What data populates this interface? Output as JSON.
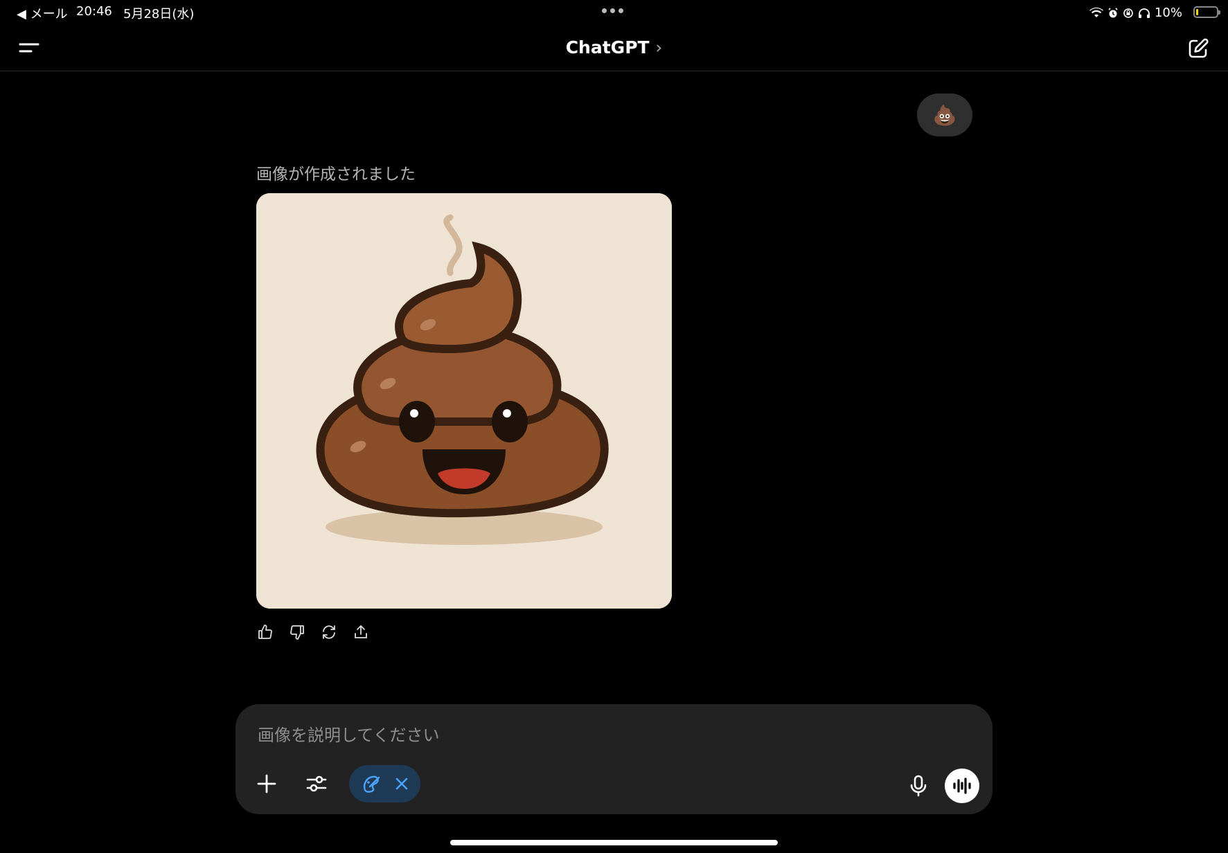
{
  "status_bar": {
    "back_label": "◀ メール",
    "time": "20:46",
    "date": "5月28日(水)",
    "battery": "10%",
    "battery_level": 0.1
  },
  "nav": {
    "title": "ChatGPT",
    "title_chevron": "›"
  },
  "conversation": {
    "user_message": "💩",
    "assistant_caption": "画像が作成されました",
    "generated_image": {
      "subject": "smiling poop emoji illustration",
      "background_color": "#efe4d3",
      "body_color": "#8a4f29",
      "outline_color": "#3a2010"
    }
  },
  "composer": {
    "placeholder": "画像を説明してください",
    "value": "",
    "active_tool": "image-creation"
  },
  "colors": {
    "background": "#000000",
    "surface": "#222222",
    "chip_background": "#1e3a55",
    "chip_accent": "#4aa3ff",
    "battery_fill": "#f5d400"
  }
}
